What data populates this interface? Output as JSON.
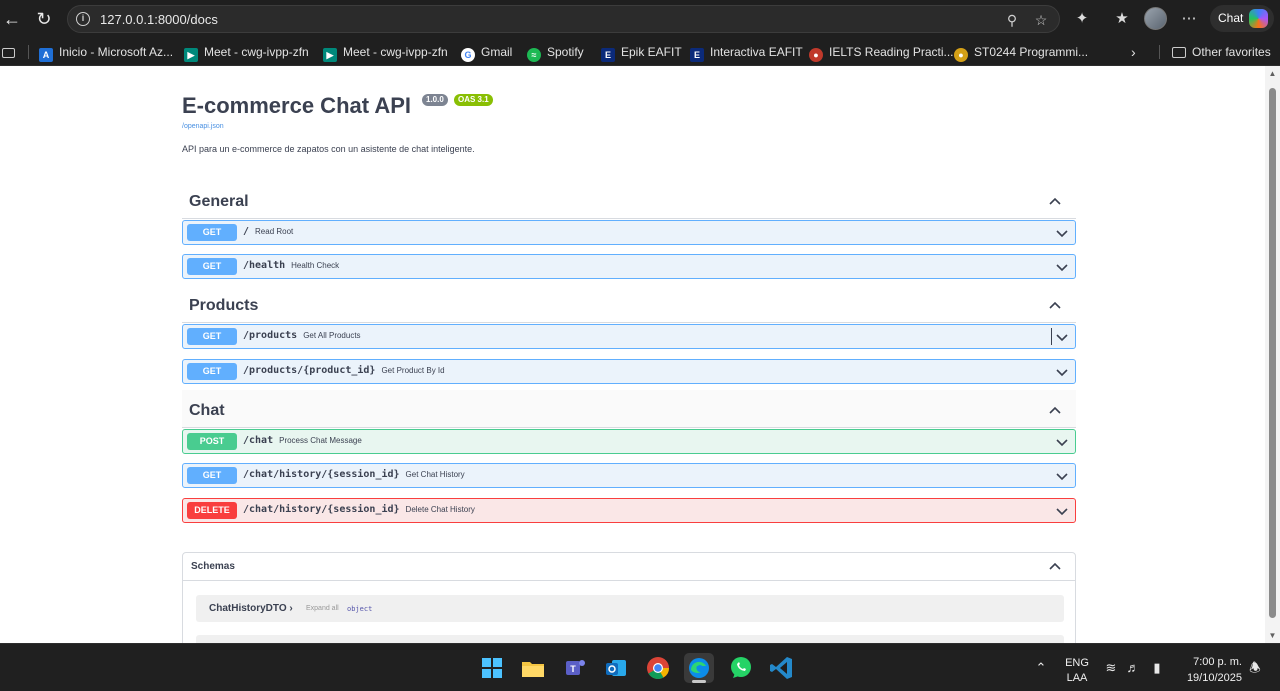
{
  "browser": {
    "url": "127.0.0.1:8000/docs",
    "chat_label": "Chat",
    "bookmarks": [
      {
        "label": "Inicio - Microsoft Az...",
        "icon": "azure-icon",
        "color": "#1f6fd6"
      },
      {
        "label": "Meet - cwg-ivpp-zfn",
        "icon": "google-meet-icon",
        "color": "#00897b"
      },
      {
        "label": "Meet - cwg-ivpp-zfn",
        "icon": "google-meet-icon",
        "color": "#00897b"
      },
      {
        "label": "Gmail",
        "icon": "google-icon",
        "color": "#ffffff"
      },
      {
        "label": "Spotify",
        "icon": "spotify-icon",
        "color": "#1db954"
      },
      {
        "label": "Epik EAFIT",
        "icon": "eafit-icon",
        "color": "#0b2a7a"
      },
      {
        "label": "Interactiva EAFIT",
        "icon": "eafit-icon",
        "color": "#0b2a7a"
      },
      {
        "label": "IELTS Reading Practi...",
        "icon": "ielts-icon",
        "color": "#c0392b"
      },
      {
        "label": "ST0244 Programmi...",
        "icon": "course-icon",
        "color": "#d4a017"
      }
    ],
    "other_favorites": "Other favorites"
  },
  "api": {
    "title": "E-commerce Chat API",
    "version": "1.0.0",
    "oas": "OAS 3.1",
    "spec_link": "/openapi.json",
    "description": "API para un e-commerce de zapatos con un asistente de chat inteligente."
  },
  "tags": [
    {
      "name": "General",
      "operations": [
        {
          "method": "GET",
          "path": "/",
          "summary": "Read Root"
        },
        {
          "method": "GET",
          "path": "/health",
          "summary": "Health Check"
        }
      ]
    },
    {
      "name": "Products",
      "operations": [
        {
          "method": "GET",
          "path": "/products",
          "summary": "Get All Products"
        },
        {
          "method": "GET",
          "path": "/products/{product_id}",
          "summary": "Get Product By Id"
        }
      ]
    },
    {
      "name": "Chat",
      "operations": [
        {
          "method": "POST",
          "path": "/chat",
          "summary": "Process Chat Message"
        },
        {
          "method": "GET",
          "path": "/chat/history/{session_id}",
          "summary": "Get Chat History"
        },
        {
          "method": "DELETE",
          "path": "/chat/history/{session_id}",
          "summary": "Delete Chat History"
        }
      ]
    }
  ],
  "schemas": {
    "title": "Schemas",
    "items": [
      {
        "name": "ChatHistoryDTO",
        "expand_label": "Expand all",
        "type": "object"
      }
    ]
  },
  "taskbar": {
    "language": "ENG",
    "layout": "LAA",
    "time": "7:00 p. m.",
    "date": "19/10/2025",
    "apps": [
      "windows-start-icon",
      "file-explorer-icon",
      "teams-icon",
      "outlook-icon",
      "chrome-icon",
      "edge-icon",
      "whatsapp-icon",
      "vscode-icon"
    ]
  }
}
